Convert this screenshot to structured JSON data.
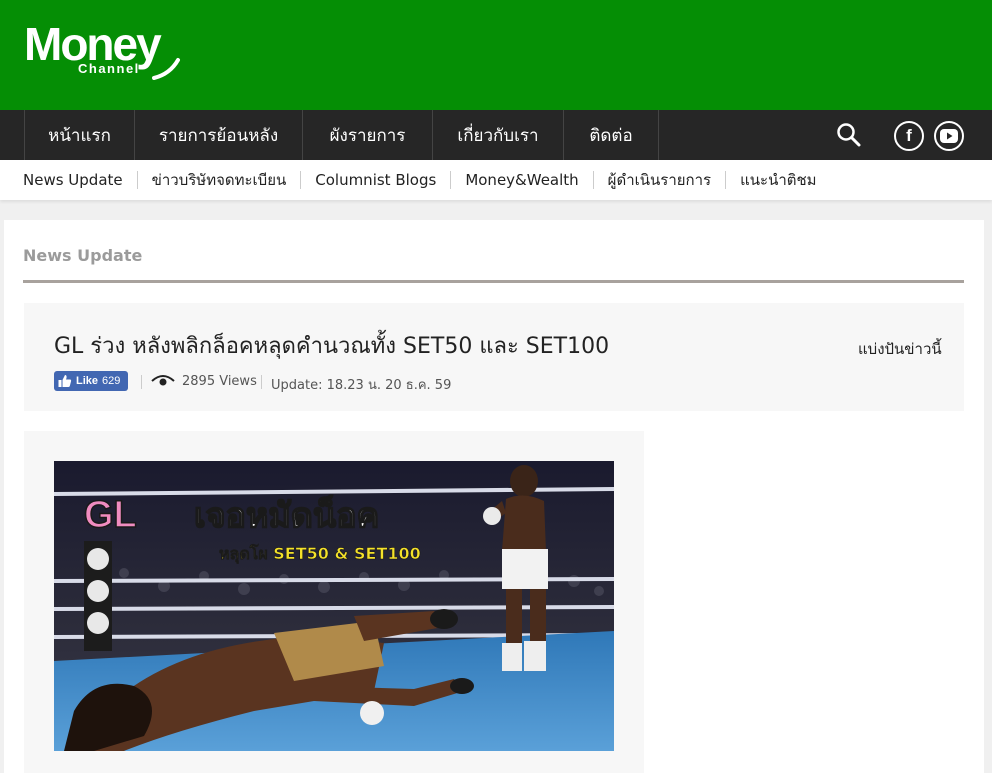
{
  "brand": {
    "logo_main": "Money",
    "logo_sub": "Channel",
    "header_color": "#058e05"
  },
  "main_nav": {
    "items": [
      "หน้าแรก",
      "รายการย้อนหลัง",
      "ผังรายการ",
      "เกี่ยวกับเรา",
      "ติดต่อ"
    ],
    "icons": [
      "search-icon",
      "facebook-icon",
      "youtube-icon"
    ]
  },
  "sub_nav": {
    "items": [
      "News Update",
      "ข่าวบริษัทจดทะเบียน",
      "Columnist Blogs",
      "Money&Wealth",
      "ผู้ดำเนินรายการ",
      "แนะนำติชม"
    ]
  },
  "section": {
    "title": "News Update"
  },
  "article": {
    "title": "GL ร่วง หลังพลิกล็อคหลุดคำนวณทั้ง SET50 และ SET100",
    "share_label": "แบ่งปันข่าวนี้",
    "like_label": "Like",
    "like_count": "629",
    "views": "2895 Views",
    "update": "Update: 18.23 น. 20 ธ.ค. 59",
    "image": {
      "headline_pink": "GL",
      "headline_white": "เจอหมัดน็อค",
      "subheadline": "หลุดโผ SET50 & SET100"
    }
  },
  "colors": {
    "nav_bg": "#262626",
    "like_blue": "#4267b2",
    "rule": "#a8a29d"
  }
}
